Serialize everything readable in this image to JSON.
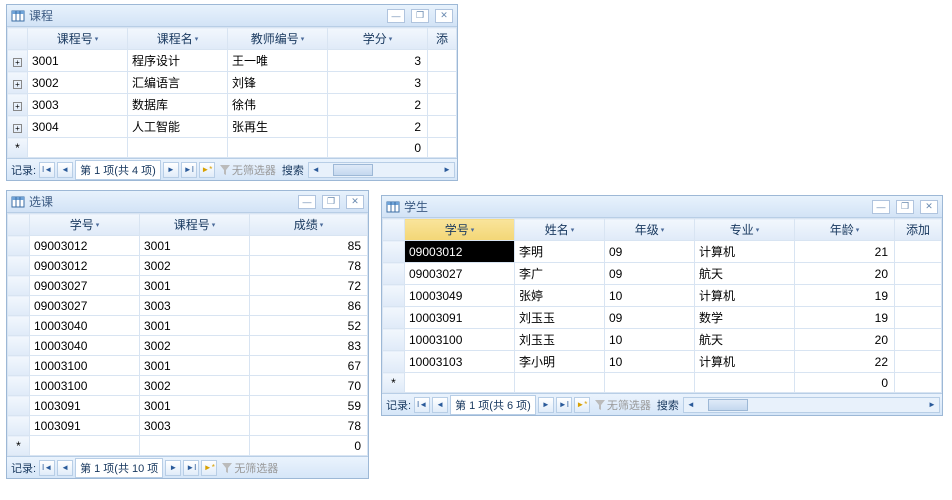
{
  "nav": {
    "record_label": "记录:",
    "filter_label": "无筛选器",
    "search_label": "搜索"
  },
  "win_course": {
    "title": "课程",
    "counter": "第 1 项(共 4 项)",
    "cols": {
      "c1": "课程号",
      "c2": "课程名",
      "c3": "教师编号",
      "c4": "学分",
      "c5": "添"
    },
    "rows": [
      {
        "id": "3001",
        "name": "程序设计",
        "teacher": "王一唯",
        "credit": "3"
      },
      {
        "id": "3002",
        "name": "汇编语言",
        "teacher": "刘锋",
        "credit": "3"
      },
      {
        "id": "3003",
        "name": "数据库",
        "teacher": "徐伟",
        "credit": "2"
      },
      {
        "id": "3004",
        "name": "人工智能",
        "teacher": "张再生",
        "credit": "2"
      }
    ],
    "newrow_credit": "0"
  },
  "win_enroll": {
    "title": "选课",
    "counter": "第 1 项(共 10 项",
    "cols": {
      "c1": "学号",
      "c2": "课程号",
      "c3": "成绩"
    },
    "rows": [
      {
        "sid": "09003012",
        "cid": "3001",
        "grade": "85"
      },
      {
        "sid": "09003012",
        "cid": "3002",
        "grade": "78"
      },
      {
        "sid": "09003027",
        "cid": "3001",
        "grade": "72"
      },
      {
        "sid": "09003027",
        "cid": "3003",
        "grade": "86"
      },
      {
        "sid": "10003040",
        "cid": "3001",
        "grade": "52"
      },
      {
        "sid": "10003040",
        "cid": "3002",
        "grade": "83"
      },
      {
        "sid": "10003100",
        "cid": "3001",
        "grade": "67"
      },
      {
        "sid": "10003100",
        "cid": "3002",
        "grade": "70"
      },
      {
        "sid": "1003091",
        "cid": "3001",
        "grade": "59"
      },
      {
        "sid": "1003091",
        "cid": "3003",
        "grade": "78"
      }
    ],
    "newrow_grade": "0"
  },
  "win_student": {
    "title": "学生",
    "counter": "第 1 项(共 6 项)",
    "cols": {
      "c1": "学号",
      "c2": "姓名",
      "c3": "年级",
      "c4": "专业",
      "c5": "年龄",
      "c6": "添加"
    },
    "rows": [
      {
        "sid": "09003012",
        "name": "李明",
        "year": "09",
        "major": "计算机",
        "age": "21"
      },
      {
        "sid": "09003027",
        "name": "李广",
        "year": "09",
        "major": "航天",
        "age": "20"
      },
      {
        "sid": "10003049",
        "name": "张婷",
        "year": "10",
        "major": "计算机",
        "age": "19"
      },
      {
        "sid": "10003091",
        "name": "刘玉玉",
        "year": "09",
        "major": "数学",
        "age": "19"
      },
      {
        "sid": "10003100",
        "name": "刘玉玉",
        "year": "10",
        "major": "航天",
        "age": "20"
      },
      {
        "sid": "10003103",
        "name": "李小明",
        "year": "10",
        "major": "计算机",
        "age": "22"
      }
    ],
    "newrow_age": "0"
  }
}
